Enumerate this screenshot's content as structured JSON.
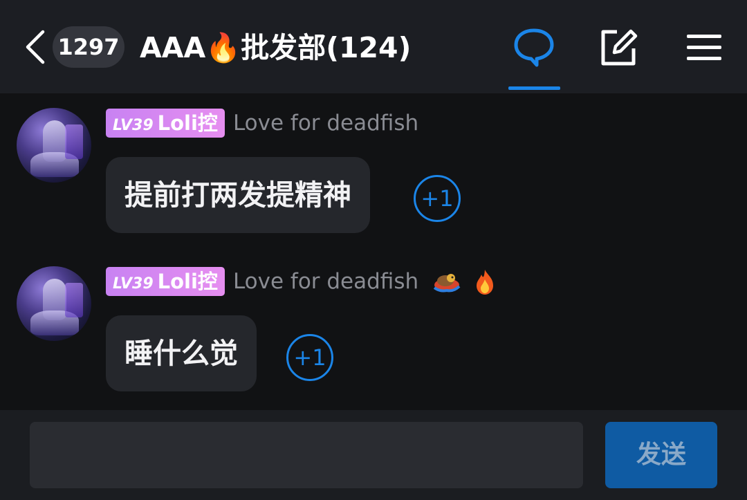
{
  "header": {
    "back_icon": "chevron-left-icon",
    "unread_count": "1297",
    "group_title": "AAA🔥批发部(124)",
    "icons": [
      "chat-bubble-icon",
      "edit-icon",
      "menu-icon"
    ],
    "active_tab": "chat",
    "accent_color": "#1b85e8"
  },
  "messages": [
    {
      "level": "LV39",
      "title_badge": "Loli控",
      "username": "Love for deadfish",
      "emojis": [],
      "text": "提前打两发提精神",
      "plus_one": "+1"
    },
    {
      "level": "LV39",
      "title_badge": "Loli控",
      "username": "Love for deadfish",
      "emojis": [
        "🐲",
        "🔥"
      ],
      "text": "睡什么觉",
      "plus_one": "+1"
    }
  ],
  "composer": {
    "input_value": "",
    "send_label": "发送"
  }
}
